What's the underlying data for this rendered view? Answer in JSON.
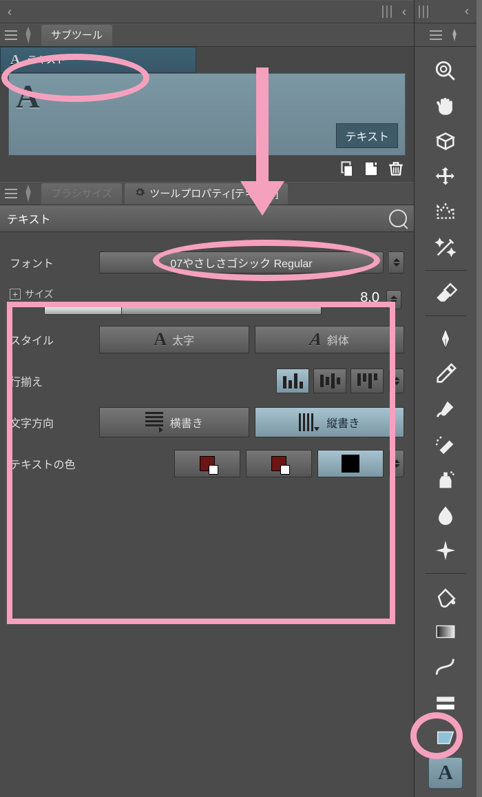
{
  "subtool_panel": {
    "tab_label": "サブツール",
    "item_label": "テキスト",
    "preview_glyph": "A",
    "preview_badge": "テキスト"
  },
  "property_panel": {
    "brush_tab": "ブラシサイズ",
    "tool_tab": "ツールプロパティ[テキスト]",
    "title": "テキスト",
    "font": {
      "label": "フォント",
      "value": "07やさしさゴシック Regular"
    },
    "size": {
      "label": "サイズ",
      "value": "8.0"
    },
    "style": {
      "label": "スタイル",
      "bold": "太字",
      "italic": "斜体"
    },
    "align": {
      "label": "行揃え"
    },
    "direction": {
      "label": "文字方向",
      "horiz": "横書き",
      "vert": "縦書き"
    },
    "color": {
      "label": "テキストの色",
      "main_hex": "#6b1515",
      "sub_hex": "#ffffff",
      "tr_main": "#6b1515",
      "tr_sub": "#ffffff",
      "bg_main": "#000000",
      "bg_sub": "#9cb8c6"
    }
  },
  "tool_sidebar": {
    "text_glyph": "A"
  }
}
